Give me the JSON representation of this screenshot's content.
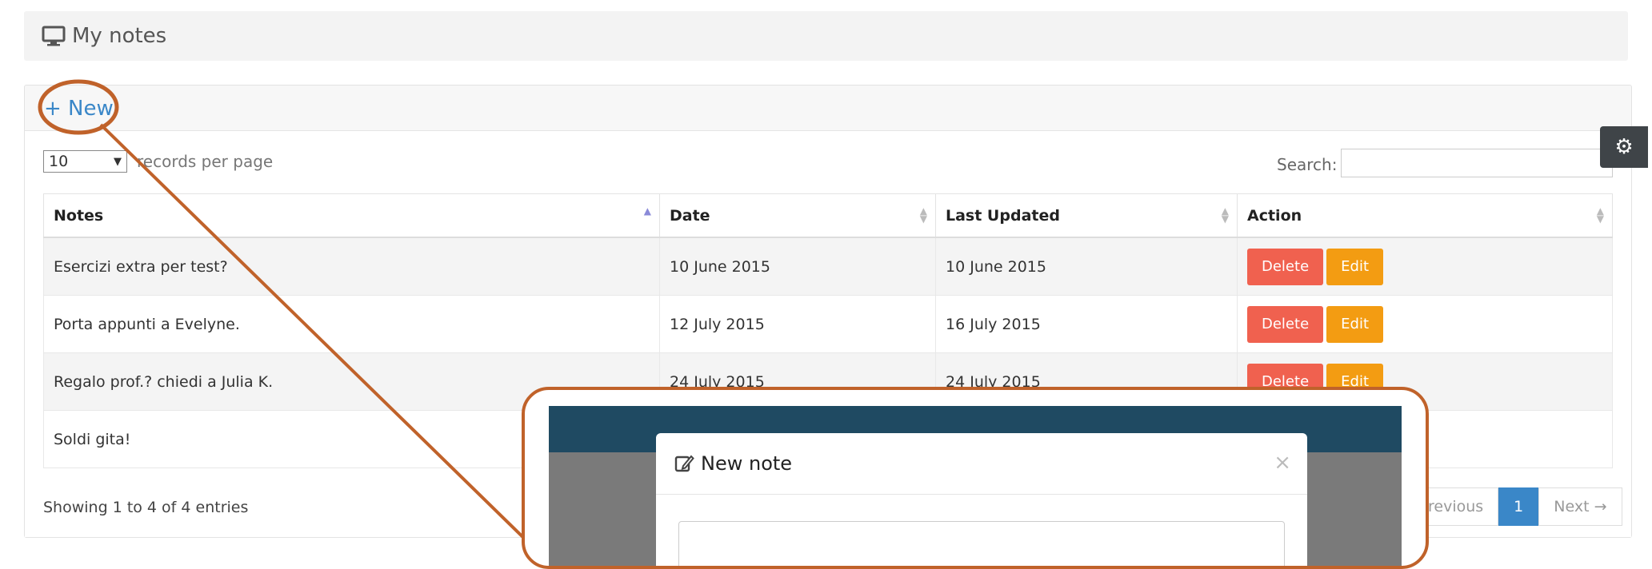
{
  "header": {
    "title": "My notes",
    "icon": "monitor-icon"
  },
  "toolbar": {
    "new_label": "+ New"
  },
  "controls": {
    "records_value": "10",
    "records_label": "records per page",
    "search_label": "Search:",
    "search_value": ""
  },
  "table": {
    "columns": [
      "Notes",
      "Date",
      "Last Updated",
      "Action"
    ],
    "rows": [
      {
        "note": "Esercizi extra per test?",
        "date": "10 June 2015",
        "updated": "10 June 2015"
      },
      {
        "note": "Porta appunti a Evelyne.",
        "date": "12 July 2015",
        "updated": "16 July 2015"
      },
      {
        "note": "Regalo prof.? chiedi a Julia K.",
        "date": "24 July 2015",
        "updated": "24 July 2015"
      },
      {
        "note": "Soldi gita!",
        "date": "",
        "updated": ""
      }
    ],
    "delete_label": "Delete",
    "edit_label": "Edit"
  },
  "footer": {
    "showing": "Showing 1 to 4 of 4 entries",
    "previous_label": "revious",
    "current_page": "1",
    "next_label": "Next →"
  },
  "modal": {
    "title": "New note",
    "close": "×",
    "icon": "edit-icon"
  },
  "colors": {
    "accent": "#3a87c8",
    "delete": "#f0614f",
    "edit": "#f39c12",
    "annotation": "#c0622a",
    "navbar": "#1f4a62"
  }
}
